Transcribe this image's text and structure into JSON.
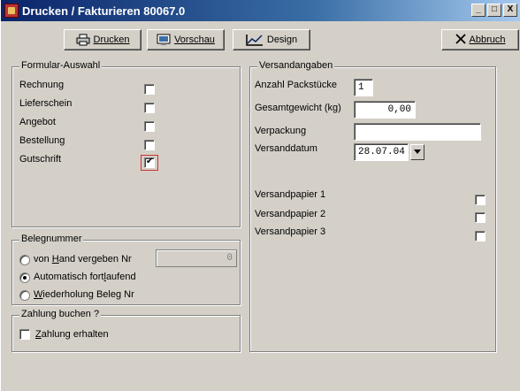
{
  "window": {
    "title": "Drucken / Fakturieren 80067.0",
    "controls": [
      "_",
      "□",
      "X"
    ]
  },
  "toolbar": {
    "print_label": "Drucken",
    "preview_label": "Vorschau",
    "design_label": "Design",
    "cancel_label": "Abbruch"
  },
  "form_selection": {
    "legend": "Formular-Auswahl",
    "items": [
      {
        "label": "Rechnung",
        "checked": false
      },
      {
        "label": "Lieferschein",
        "checked": false
      },
      {
        "label": "Angebot",
        "checked": false
      },
      {
        "label": "Bestellung",
        "checked": false
      },
      {
        "label": "Gutschrift",
        "checked": true
      }
    ]
  },
  "receipt_number": {
    "legend": "Belegnummer",
    "options": [
      {
        "label": "von Hand vergeben Nr",
        "selected": false
      },
      {
        "label": "Automatisch fortlaufend",
        "selected": true
      },
      {
        "label": "Wiederholung Beleg Nr",
        "selected": false
      }
    ],
    "manual_number_value": "0"
  },
  "payment": {
    "legend": "Zahlung buchen ?",
    "received_label": "Zahlung erhalten",
    "received_checked": false
  },
  "shipping": {
    "legend": "Versandangaben",
    "packages_label": "Anzahl Packstücke",
    "packages_value": "1",
    "weight_label": "Gesamtgewicht (kg)",
    "weight_value": "0,00",
    "packaging_label": "Verpackung",
    "packaging_value": "",
    "date_label": "Versanddatum",
    "date_value": "28.07.04",
    "papers": [
      {
        "label": "Versandpapier 1",
        "checked": false
      },
      {
        "label": "Versandpapier 2",
        "checked": false
      },
      {
        "label": "Versandpapier 3",
        "checked": false
      }
    ]
  },
  "colors": {
    "titlebar": "#0a246a",
    "face": "#d4d0c8",
    "focus": "#d03030"
  }
}
